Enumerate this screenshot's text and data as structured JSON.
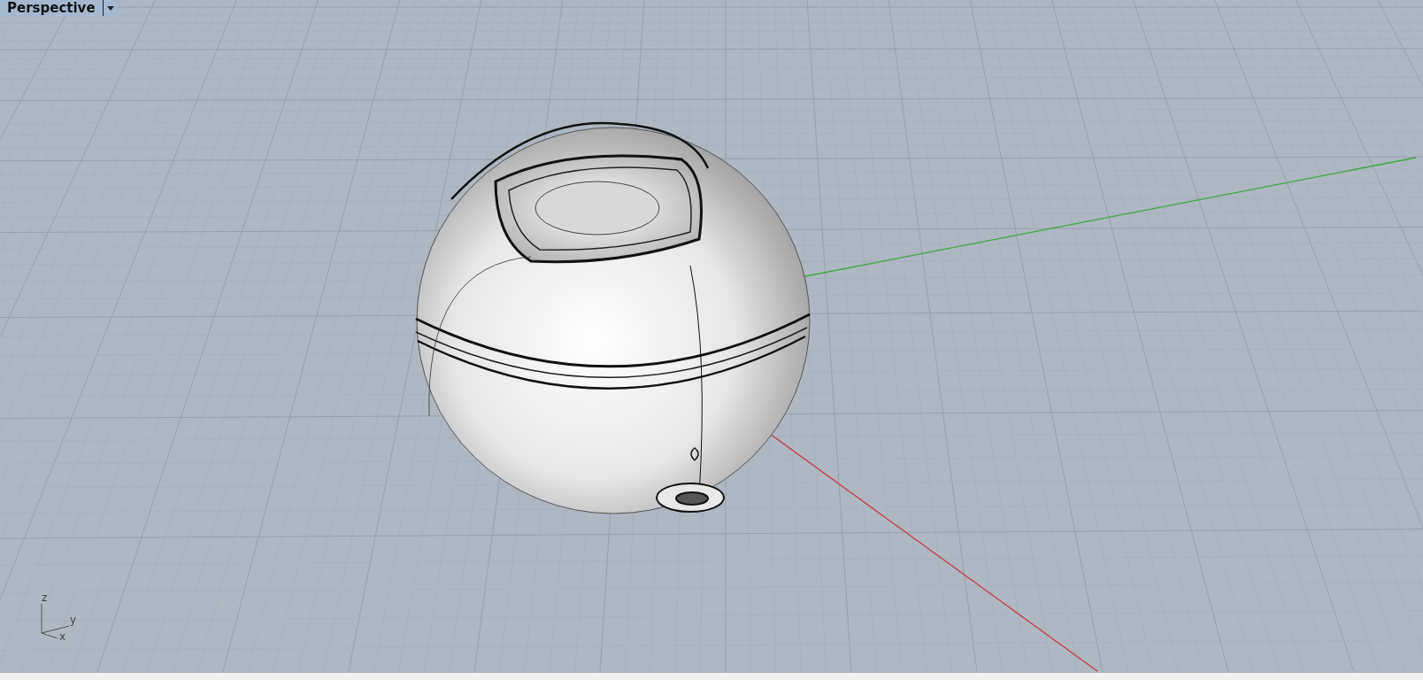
{
  "viewport": {
    "title": "Perspective",
    "gizmo_labels": [
      "z",
      "y",
      "x"
    ]
  }
}
